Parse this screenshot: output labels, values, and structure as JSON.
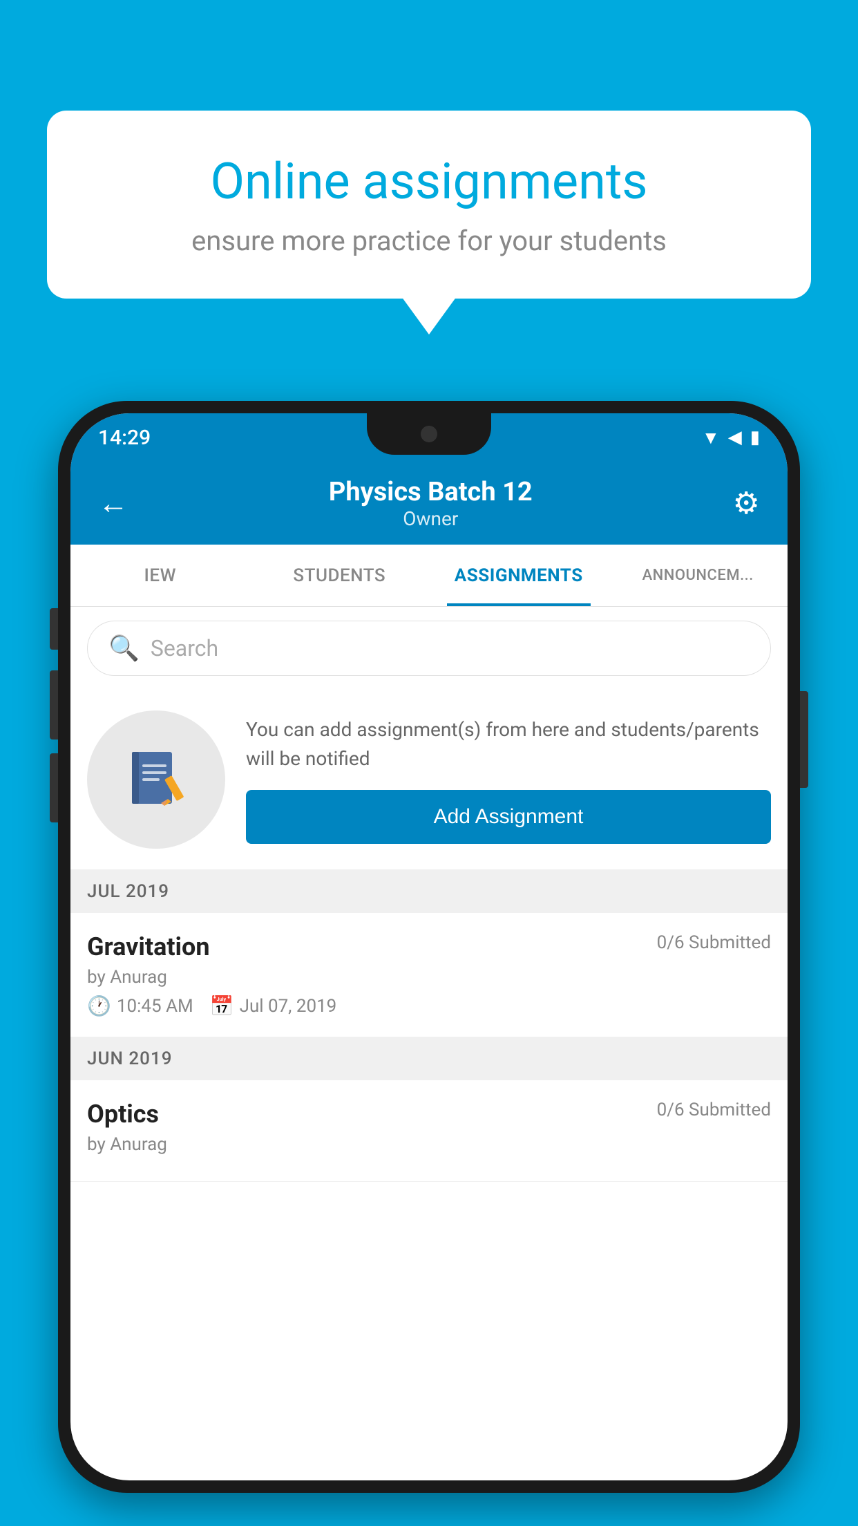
{
  "background_color": "#00AADE",
  "speech_bubble": {
    "title": "Online assignments",
    "subtitle": "ensure more practice for your students"
  },
  "status_bar": {
    "time": "14:29",
    "wifi_icon": "▲",
    "signal_icon": "◀",
    "battery_icon": "▬"
  },
  "app_bar": {
    "back_label": "←",
    "batch_name": "Physics Batch 12",
    "batch_role": "Owner",
    "settings_label": "⚙"
  },
  "tabs": [
    {
      "label": "IEW",
      "active": false
    },
    {
      "label": "STUDENTS",
      "active": false
    },
    {
      "label": "ASSIGNMENTS",
      "active": true
    },
    {
      "label": "ANNOUNCEM...",
      "active": false
    }
  ],
  "search": {
    "placeholder": "Search"
  },
  "add_section": {
    "description": "You can add assignment(s) from here and students/parents will be notified",
    "button_label": "Add Assignment"
  },
  "sections": [
    {
      "month": "JUL 2019",
      "assignments": [
        {
          "name": "Gravitation",
          "submitted": "0/6 Submitted",
          "by": "by Anurag",
          "time": "10:45 AM",
          "date": "Jul 07, 2019"
        }
      ]
    },
    {
      "month": "JUN 2019",
      "assignments": [
        {
          "name": "Optics",
          "submitted": "0/6 Submitted",
          "by": "by Anurag",
          "time": "",
          "date": ""
        }
      ]
    }
  ]
}
